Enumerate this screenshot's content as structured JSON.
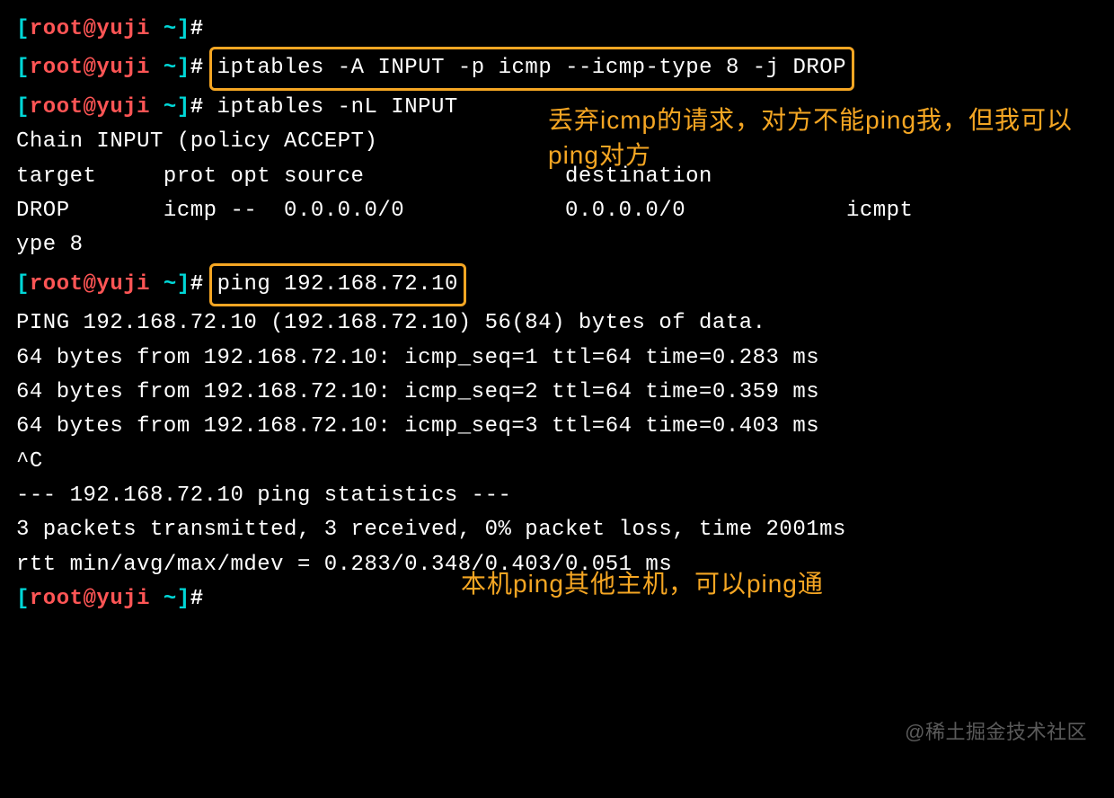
{
  "prompt": {
    "open": "[",
    "user": "root",
    "at": "@",
    "host": "yuji",
    "space_tilde": " ~",
    "close": "]",
    "hash": "#"
  },
  "lines": {
    "empty_cmd": " ",
    "cmd1": "iptables -A INPUT -p icmp --icmp-type 8 -j DROP",
    "cmd2": " iptables -nL INPUT",
    "chain_line": "Chain INPUT (policy ACCEPT)",
    "header_line": "target     prot opt source               destination",
    "rule_line_a": "DROP       icmp --  0.0.0.0/0            0.0.0.0/0            icmpt",
    "rule_line_b": "ype 8",
    "cmd3": "ping 192.168.72.10",
    "ping_start": "PING 192.168.72.10 (192.168.72.10) 56(84) bytes of data.",
    "ping1": "64 bytes from 192.168.72.10: icmp_seq=1 ttl=64 time=0.283 ms",
    "ping2": "64 bytes from 192.168.72.10: icmp_seq=2 ttl=64 time=0.359 ms",
    "ping3": "64 bytes from 192.168.72.10: icmp_seq=3 ttl=64 time=0.403 ms",
    "ctrl_c": "^C",
    "stats_header": "--- 192.168.72.10 ping statistics ---",
    "stats1": "3 packets transmitted, 3 received, 0% packet loss, time 2001ms",
    "stats2": "rtt min/avg/max/mdev = 0.283/0.348/0.403/0.051 ms"
  },
  "annotations": {
    "a1": "丢弃icmp的请求，对方不能ping我，但我可以ping对方",
    "a2": "本机ping其他主机，可以ping通"
  },
  "watermark": "@稀土掘金技术社区"
}
